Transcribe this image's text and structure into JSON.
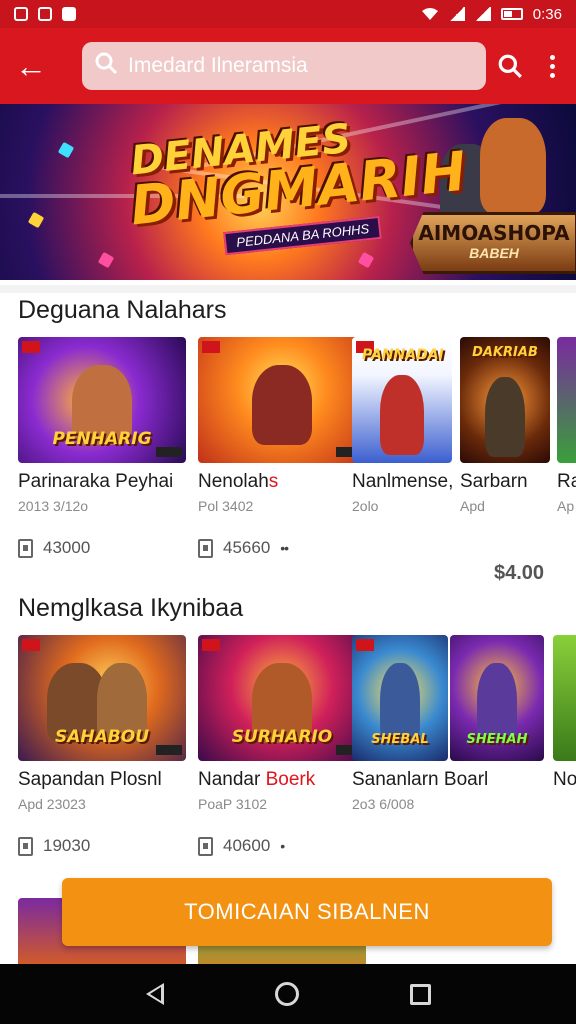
{
  "status_bar": {
    "time": "0:36",
    "icons": [
      "notification-icon",
      "gallery-icon",
      "youtube-icon",
      "wifi-icon",
      "signal-icon",
      "battery-icon"
    ]
  },
  "app_bar": {
    "search_placeholder": "Imedard Ilneramsia",
    "icons": [
      "back-arrow-icon",
      "search-icon",
      "more-vert-icon"
    ]
  },
  "banner": {
    "title_line1": "DENAMES",
    "title_line2": "DNGMARIH",
    "subtitle": "PEDDANA BA ROHHS",
    "badge_line1": "AIMOASHOPA",
    "badge_line2": "BABEH"
  },
  "sections": [
    {
      "title": "Deguana Nalahars",
      "cards": [
        {
          "title": "Parinaraka Peyhai",
          "title_hl": "",
          "sub": "2013 3/12o",
          "stat": "43000",
          "extra": "",
          "logo": "PENHARIG"
        },
        {
          "title": "Nenolah",
          "title_hl": "s",
          "sub": "Pol 3402",
          "stat": "45660",
          "extra": "••",
          "logo": ""
        },
        {
          "title": "Nanlmense,",
          "title_hl": "",
          "sub": "2olo",
          "stat": "",
          "extra": "",
          "logo": "PANNADAI"
        },
        {
          "title": "Sarbarn",
          "title_hl": "",
          "sub": "Apd",
          "stat": "",
          "extra": "",
          "logo": "DAKRIAB"
        },
        {
          "title": "Ra",
          "title_hl": "",
          "sub": "Ap",
          "stat": "",
          "extra": "",
          "logo": ""
        }
      ],
      "price": "$4.00"
    },
    {
      "title": "Nemglkasa Ikynibaa",
      "cards": [
        {
          "title": "Sapandan Plosnl",
          "title_hl": "",
          "sub": "Apd 23023",
          "stat": "19030",
          "extra": "",
          "logo": "SAHABOU"
        },
        {
          "title": "Nandar ",
          "title_hl": "Boerk",
          "sub": "PoaP 3102",
          "stat": "40600",
          "extra": "•",
          "logo": "SURHARIO"
        },
        {
          "title": "Sananlarn Boarl",
          "title_hl": "",
          "sub": "2o3 6/008",
          "stat": "",
          "extra": "",
          "logo": "SHEBAL"
        },
        {
          "title": "",
          "title_hl": "",
          "sub": "",
          "stat": "",
          "extra": "",
          "logo": "SHEHAH"
        },
        {
          "title": "No",
          "title_hl": "",
          "sub": "",
          "stat": "",
          "extra": "",
          "logo": ""
        }
      ]
    }
  ],
  "install_button": "TOMICAIAN SIBALNEN",
  "nav": {
    "icons": [
      "nav-back-icon",
      "nav-home-icon",
      "nav-recents-icon"
    ]
  },
  "colors": {
    "primary": "#d8171f",
    "status": "#c8141c",
    "accent": "#f39212"
  }
}
